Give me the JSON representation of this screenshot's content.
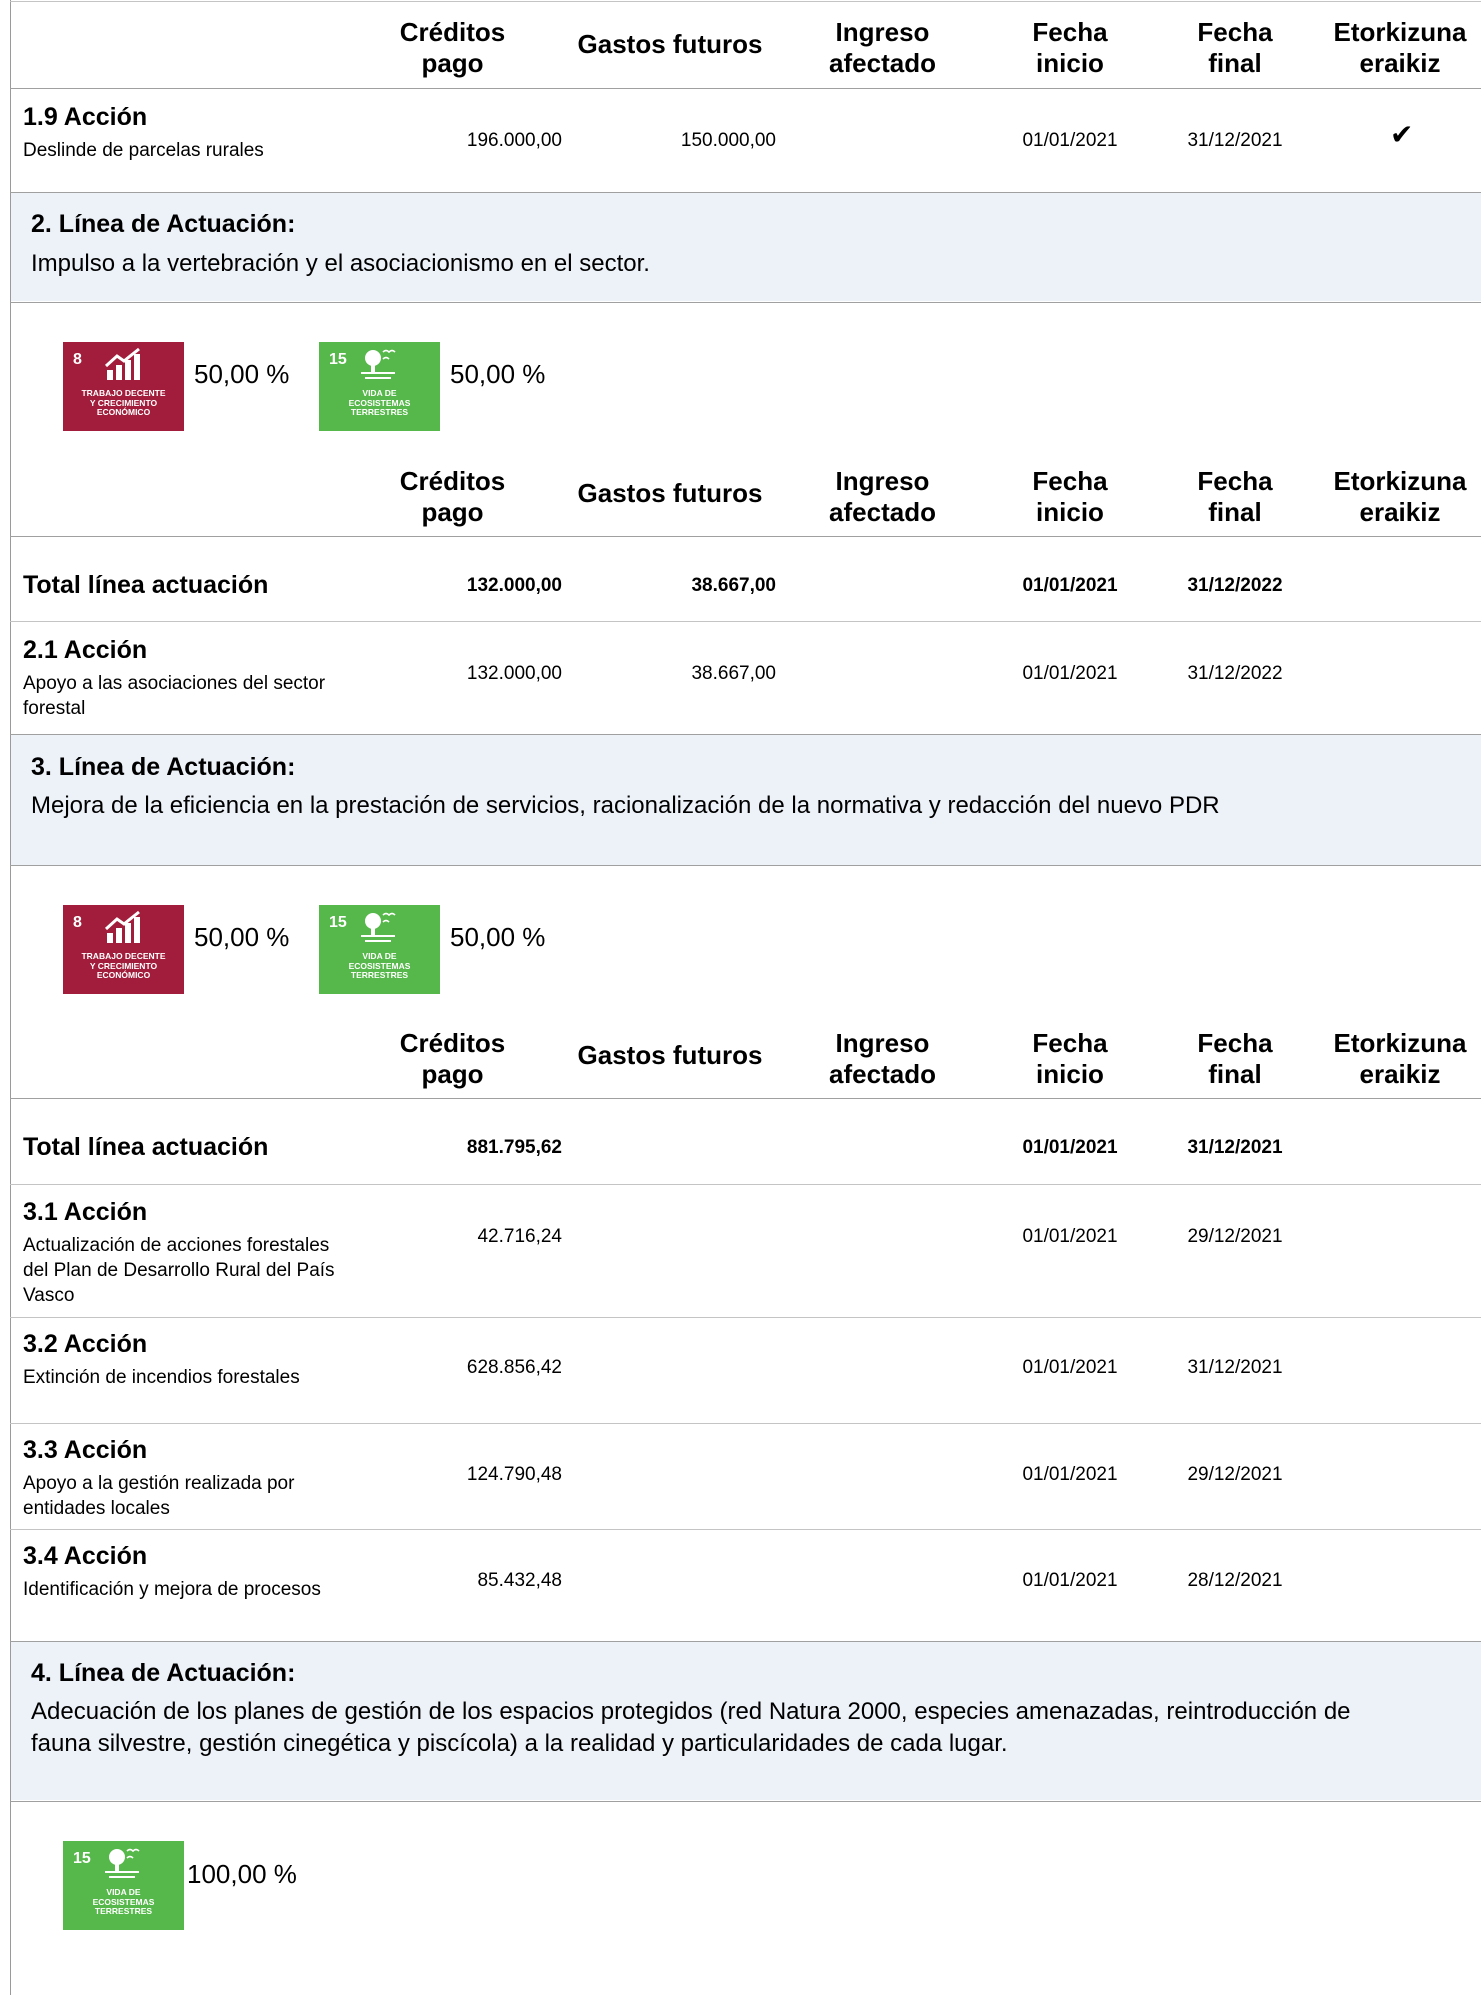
{
  "headers": {
    "creditos": "Créditos pago",
    "creditos_l1": "Créditos",
    "creditos_l2": "pago",
    "gastos": "Gastos futuros",
    "ingreso_l1": "Ingreso",
    "ingreso_l2": "afectado",
    "fecha_inicio_l1": "Fecha",
    "fecha_inicio_l2": "inicio",
    "fecha_final_l1": "Fecha",
    "fecha_final_l2": "final",
    "etork_l1": "Etorkizuna",
    "etork_l2": "eraikiz"
  },
  "accion_1_9": {
    "title": "1.9 Acción",
    "desc": "Deslinde de parcelas rurales",
    "creditos": "196.000,00",
    "gastos": "150.000,00",
    "inicio": "01/01/2021",
    "final": "31/12/2021",
    "etorkizuna_check": "✔"
  },
  "linea2": {
    "title": "2. Línea de Actuación:",
    "text": "Impulso a la vertebración y el asociacionismo en el sector.",
    "ods": [
      {
        "number": "8",
        "label_l1": "TRABAJO DECENTE",
        "label_l2": "Y CRECIMIENTO",
        "label_l3": "ECONÓMICO",
        "pct": "50,00 %",
        "color": "#a21d3b",
        "icon": "growth-chart-icon"
      },
      {
        "number": "15",
        "label_l1": "VIDA DE",
        "label_l2": "ECOSISTEMAS",
        "label_l3": "TERRESTRES",
        "pct": "50,00 %",
        "color": "#56b84a",
        "icon": "tree-bird-icon"
      }
    ],
    "total": {
      "label": "Total línea actuación",
      "creditos": "132.000,00",
      "gastos": "38.667,00",
      "inicio": "01/01/2021",
      "final": "31/12/2022"
    },
    "acciones": [
      {
        "title": "2.1 Acción",
        "desc": "Apoyo  a las asociaciones del sector forestal",
        "creditos": "132.000,00",
        "gastos": "38.667,00",
        "inicio": "01/01/2021",
        "final": "31/12/2022"
      }
    ]
  },
  "linea3": {
    "title": "3. Línea de Actuación:",
    "text": "Mejora de la eficiencia en la prestación de servicios, racionalización de la normativa y redacción del nuevo PDR",
    "ods": [
      {
        "number": "8",
        "label_l1": "TRABAJO DECENTE",
        "label_l2": "Y CRECIMIENTO",
        "label_l3": "ECONÓMICO",
        "pct": "50,00 %",
        "color": "#a21d3b",
        "icon": "growth-chart-icon"
      },
      {
        "number": "15",
        "label_l1": "VIDA DE",
        "label_l2": "ECOSISTEMAS",
        "label_l3": "TERRESTRES",
        "pct": "50,00 %",
        "color": "#56b84a",
        "icon": "tree-bird-icon"
      }
    ],
    "total": {
      "label": "Total línea actuación",
      "creditos": "881.795,62",
      "inicio": "01/01/2021",
      "final": "31/12/2021"
    },
    "acciones": [
      {
        "title": "3.1 Acción",
        "desc": "Actualización de acciones forestales del Plan de Desarrollo Rural del País Vasco",
        "creditos": "42.716,24",
        "inicio": "01/01/2021",
        "final": "29/12/2021"
      },
      {
        "title": "3.2 Acción",
        "desc": "Extinción de incendios forestales",
        "creditos": "628.856,42",
        "inicio": "01/01/2021",
        "final": "31/12/2021"
      },
      {
        "title": "3.3 Acción",
        "desc": "Apoyo a la gestión realizada por entidades locales",
        "creditos": "124.790,48",
        "inicio": "01/01/2021",
        "final": "29/12/2021"
      },
      {
        "title": "3.4 Acción",
        "desc": "Identificación y mejora de procesos",
        "creditos": "85.432,48",
        "inicio": "01/01/2021",
        "final": "28/12/2021"
      }
    ]
  },
  "linea4": {
    "title": "4. Línea de Actuación:",
    "text": "Adecuación de los planes de gestión de los espacios protegidos (red Natura 2000, especies amenazadas, reintroducción de fauna silvestre, gestión cinegética y piscícola) a la realidad y particularidades de cada lugar.",
    "ods": [
      {
        "number": "15",
        "label_l1": "VIDA DE",
        "label_l2": "ECOSISTEMAS",
        "label_l3": "TERRESTRES",
        "pct": "100,00 %",
        "color": "#56b84a",
        "icon": "tree-bird-icon"
      }
    ]
  }
}
